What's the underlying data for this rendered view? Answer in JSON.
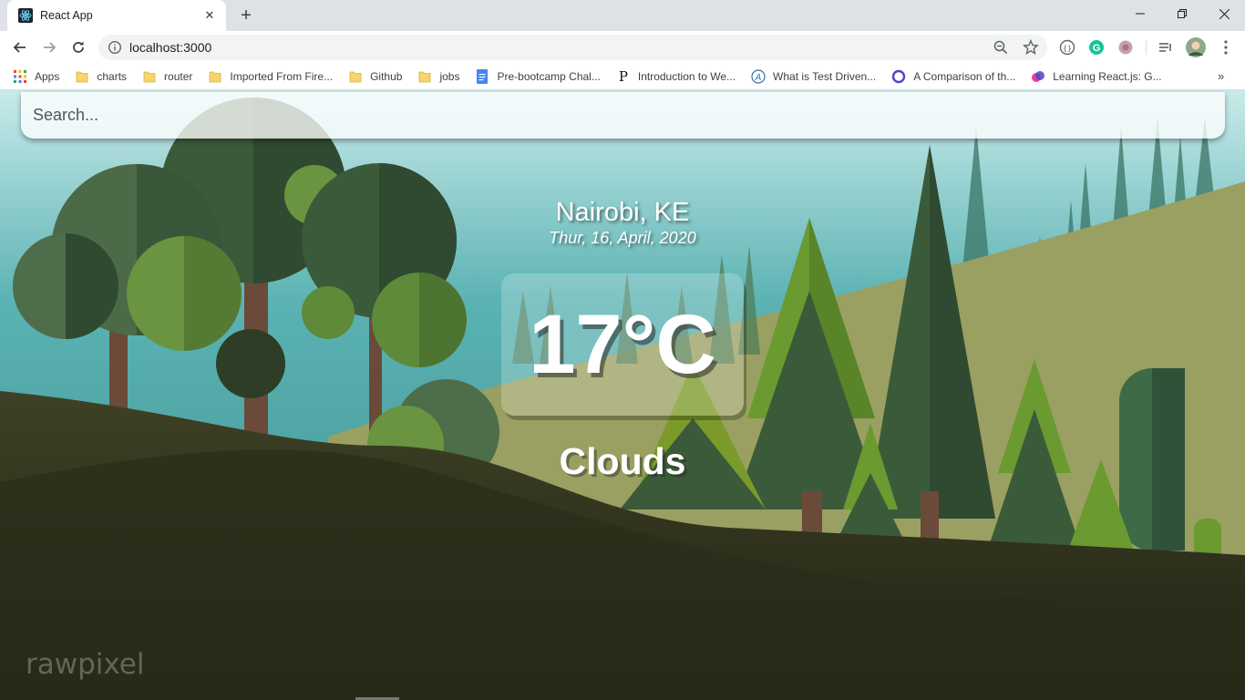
{
  "browser": {
    "tab_title": "React App",
    "url": "localhost:3000",
    "bookmarks": [
      {
        "label": "Apps",
        "icon": "apps-grid-icon"
      },
      {
        "label": "charts",
        "icon": "folder-icon"
      },
      {
        "label": "router",
        "icon": "folder-icon"
      },
      {
        "label": "Imported From Fire...",
        "icon": "folder-icon"
      },
      {
        "label": "Github",
        "icon": "folder-icon"
      },
      {
        "label": "jobs",
        "icon": "folder-icon"
      },
      {
        "label": "Pre-bootcamp Chal...",
        "icon": "google-docs-icon"
      },
      {
        "label": "Introduction to We...",
        "icon": "p-logo-icon"
      },
      {
        "label": "What is Test Driven...",
        "icon": "a-logo-icon"
      },
      {
        "label": "A Comparison of th...",
        "icon": "ring-logo-icon"
      },
      {
        "label": "Learning React.js: G...",
        "icon": "blob-logo-icon"
      }
    ],
    "overflow_label": "»"
  },
  "app": {
    "search_placeholder": "Search...",
    "location": "Nairobi, KE",
    "date": "Thur, 16, April, 2020",
    "temperature": "17°C",
    "condition": "Clouds",
    "watermark": "rawpixel"
  },
  "colors": {
    "sky": "#5fb3b3",
    "hill_back": "#9aa061",
    "hill_front": "#36381f",
    "tree_dark": "#2f4a30",
    "tree_light": "#5f8a3a"
  }
}
